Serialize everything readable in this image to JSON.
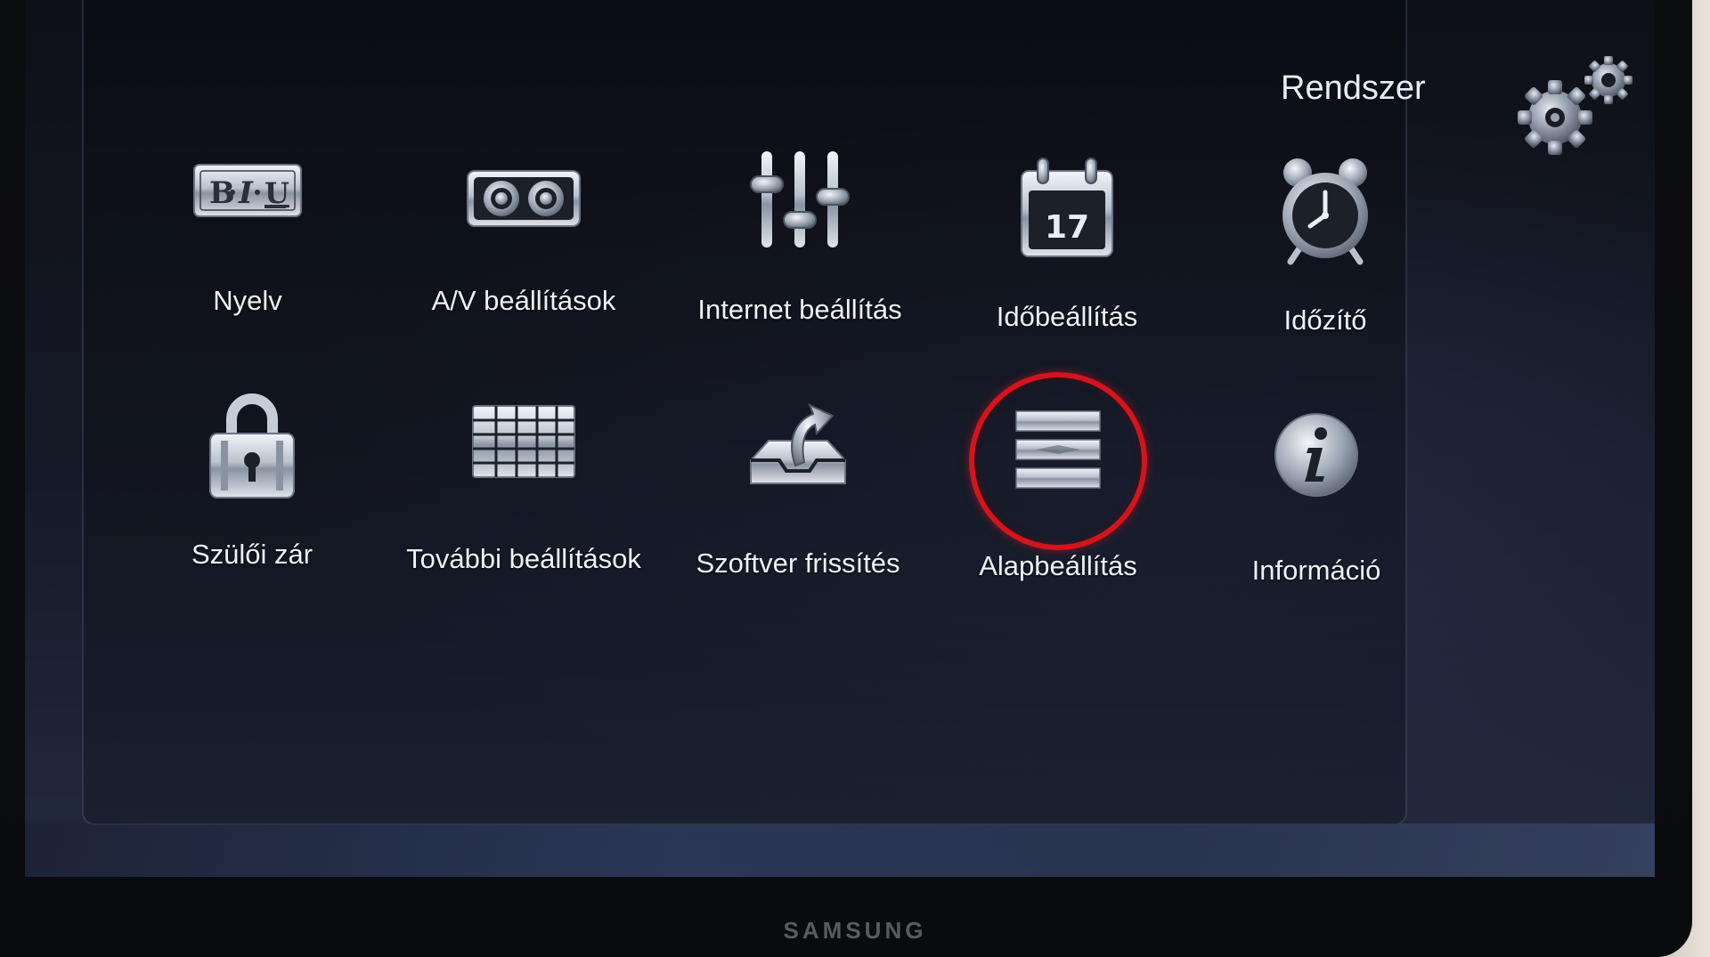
{
  "header": {
    "title": "Rendszer",
    "icon": "gears-icon"
  },
  "menu": {
    "selected_index": 8,
    "accent_color": "#d4141c",
    "items": [
      {
        "label": "Nyelv",
        "icon": "language-biu-icon"
      },
      {
        "label": "A/V beállítások",
        "icon": "av-speaker-icon"
      },
      {
        "label": "Internet beállítás",
        "icon": "sliders-icon"
      },
      {
        "label": "Időbeállítás",
        "icon": "calendar-icon",
        "icon_text": "17"
      },
      {
        "label": "Időzítő",
        "icon": "alarm-clock-icon"
      },
      {
        "label": "Szülői zár",
        "icon": "padlock-icon"
      },
      {
        "label": "További beállítások",
        "icon": "grid-table-icon"
      },
      {
        "label": "Szoftver frissítés",
        "icon": "software-update-tray-icon"
      },
      {
        "label": "Alapbeállítás",
        "icon": "factory-reset-bars-icon"
      },
      {
        "label": "Információ",
        "icon": "info-icon"
      }
    ]
  },
  "brand": "SAMSUNG"
}
